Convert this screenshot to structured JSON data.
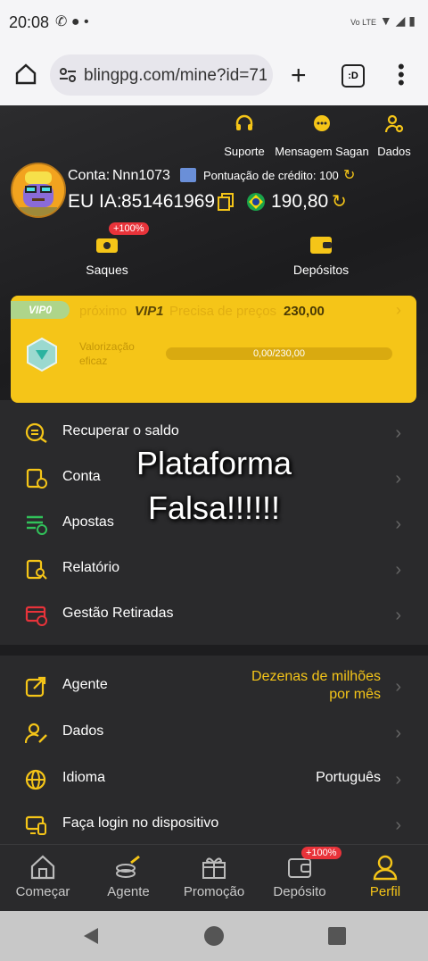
{
  "status_bar": {
    "time": "20:08",
    "network": "Vo LTE"
  },
  "browser": {
    "url": "blingpg.com/mine?id=71"
  },
  "quick_actions": [
    {
      "label": "Suporte",
      "icon": "headset-icon"
    },
    {
      "label": "Mensagem Sagan",
      "icon": "chat-icon"
    },
    {
      "label": "Dados",
      "icon": "user-gear-icon"
    }
  ],
  "account": {
    "conta_label": "Conta:",
    "conta_value": "Nnn1073",
    "credit_label": "Pontuação de crédito: 100",
    "id_label": "EU IA:",
    "id_value": "851461969",
    "balance": "190,80"
  },
  "wallet": {
    "saques_label": "Saques",
    "saques_badge": "+100%",
    "depositos_label": "Depósitos"
  },
  "vip": {
    "badge": "VIP0",
    "next_label": "próximo",
    "next_level": "VIP1",
    "need_label": "Precisa de preços",
    "need_value": "230,00",
    "valor_label_1": "Valorização",
    "valor_label_2": "eficaz",
    "progress_text": "0,00/230,00",
    "progress_fraction": 0.0
  },
  "overlay_text": {
    "line1": "Plataforma",
    "line2": "Falsa!!!!!!"
  },
  "menu1": [
    {
      "label": "Recuperar o saldo",
      "icon": "coins-icon"
    },
    {
      "label": "Conta",
      "icon": "account-doc-icon"
    },
    {
      "label": "Apostas",
      "icon": "bets-list-icon"
    },
    {
      "label": "Relatório",
      "icon": "report-icon"
    },
    {
      "label": "Gestão Retiradas",
      "icon": "withdraw-card-icon"
    }
  ],
  "menu2": [
    {
      "label": "Agente",
      "value_line1": "Dezenas de milhões",
      "value_line2": "por mês",
      "icon": "share-icon"
    },
    {
      "label": "Dados",
      "value": "",
      "icon": "user-edit-icon"
    },
    {
      "label": "Idioma",
      "value": "Português",
      "icon": "globe-icon"
    },
    {
      "label": "Faça login no dispositivo",
      "value": "",
      "icon": "devices-icon"
    }
  ],
  "bottom_nav": [
    {
      "label": "Começar",
      "icon": "home-icon"
    },
    {
      "label": "Agente",
      "icon": "agent-icon"
    },
    {
      "label": "Promoção",
      "icon": "gift-icon"
    },
    {
      "label": "Depósito",
      "icon": "deposit-icon",
      "badge": "+100%"
    },
    {
      "label": "Perfil",
      "icon": "profile-icon"
    }
  ],
  "colors": {
    "accent": "#f5c518",
    "background": "#2a2a2c",
    "badge_red": "#e8333a"
  }
}
